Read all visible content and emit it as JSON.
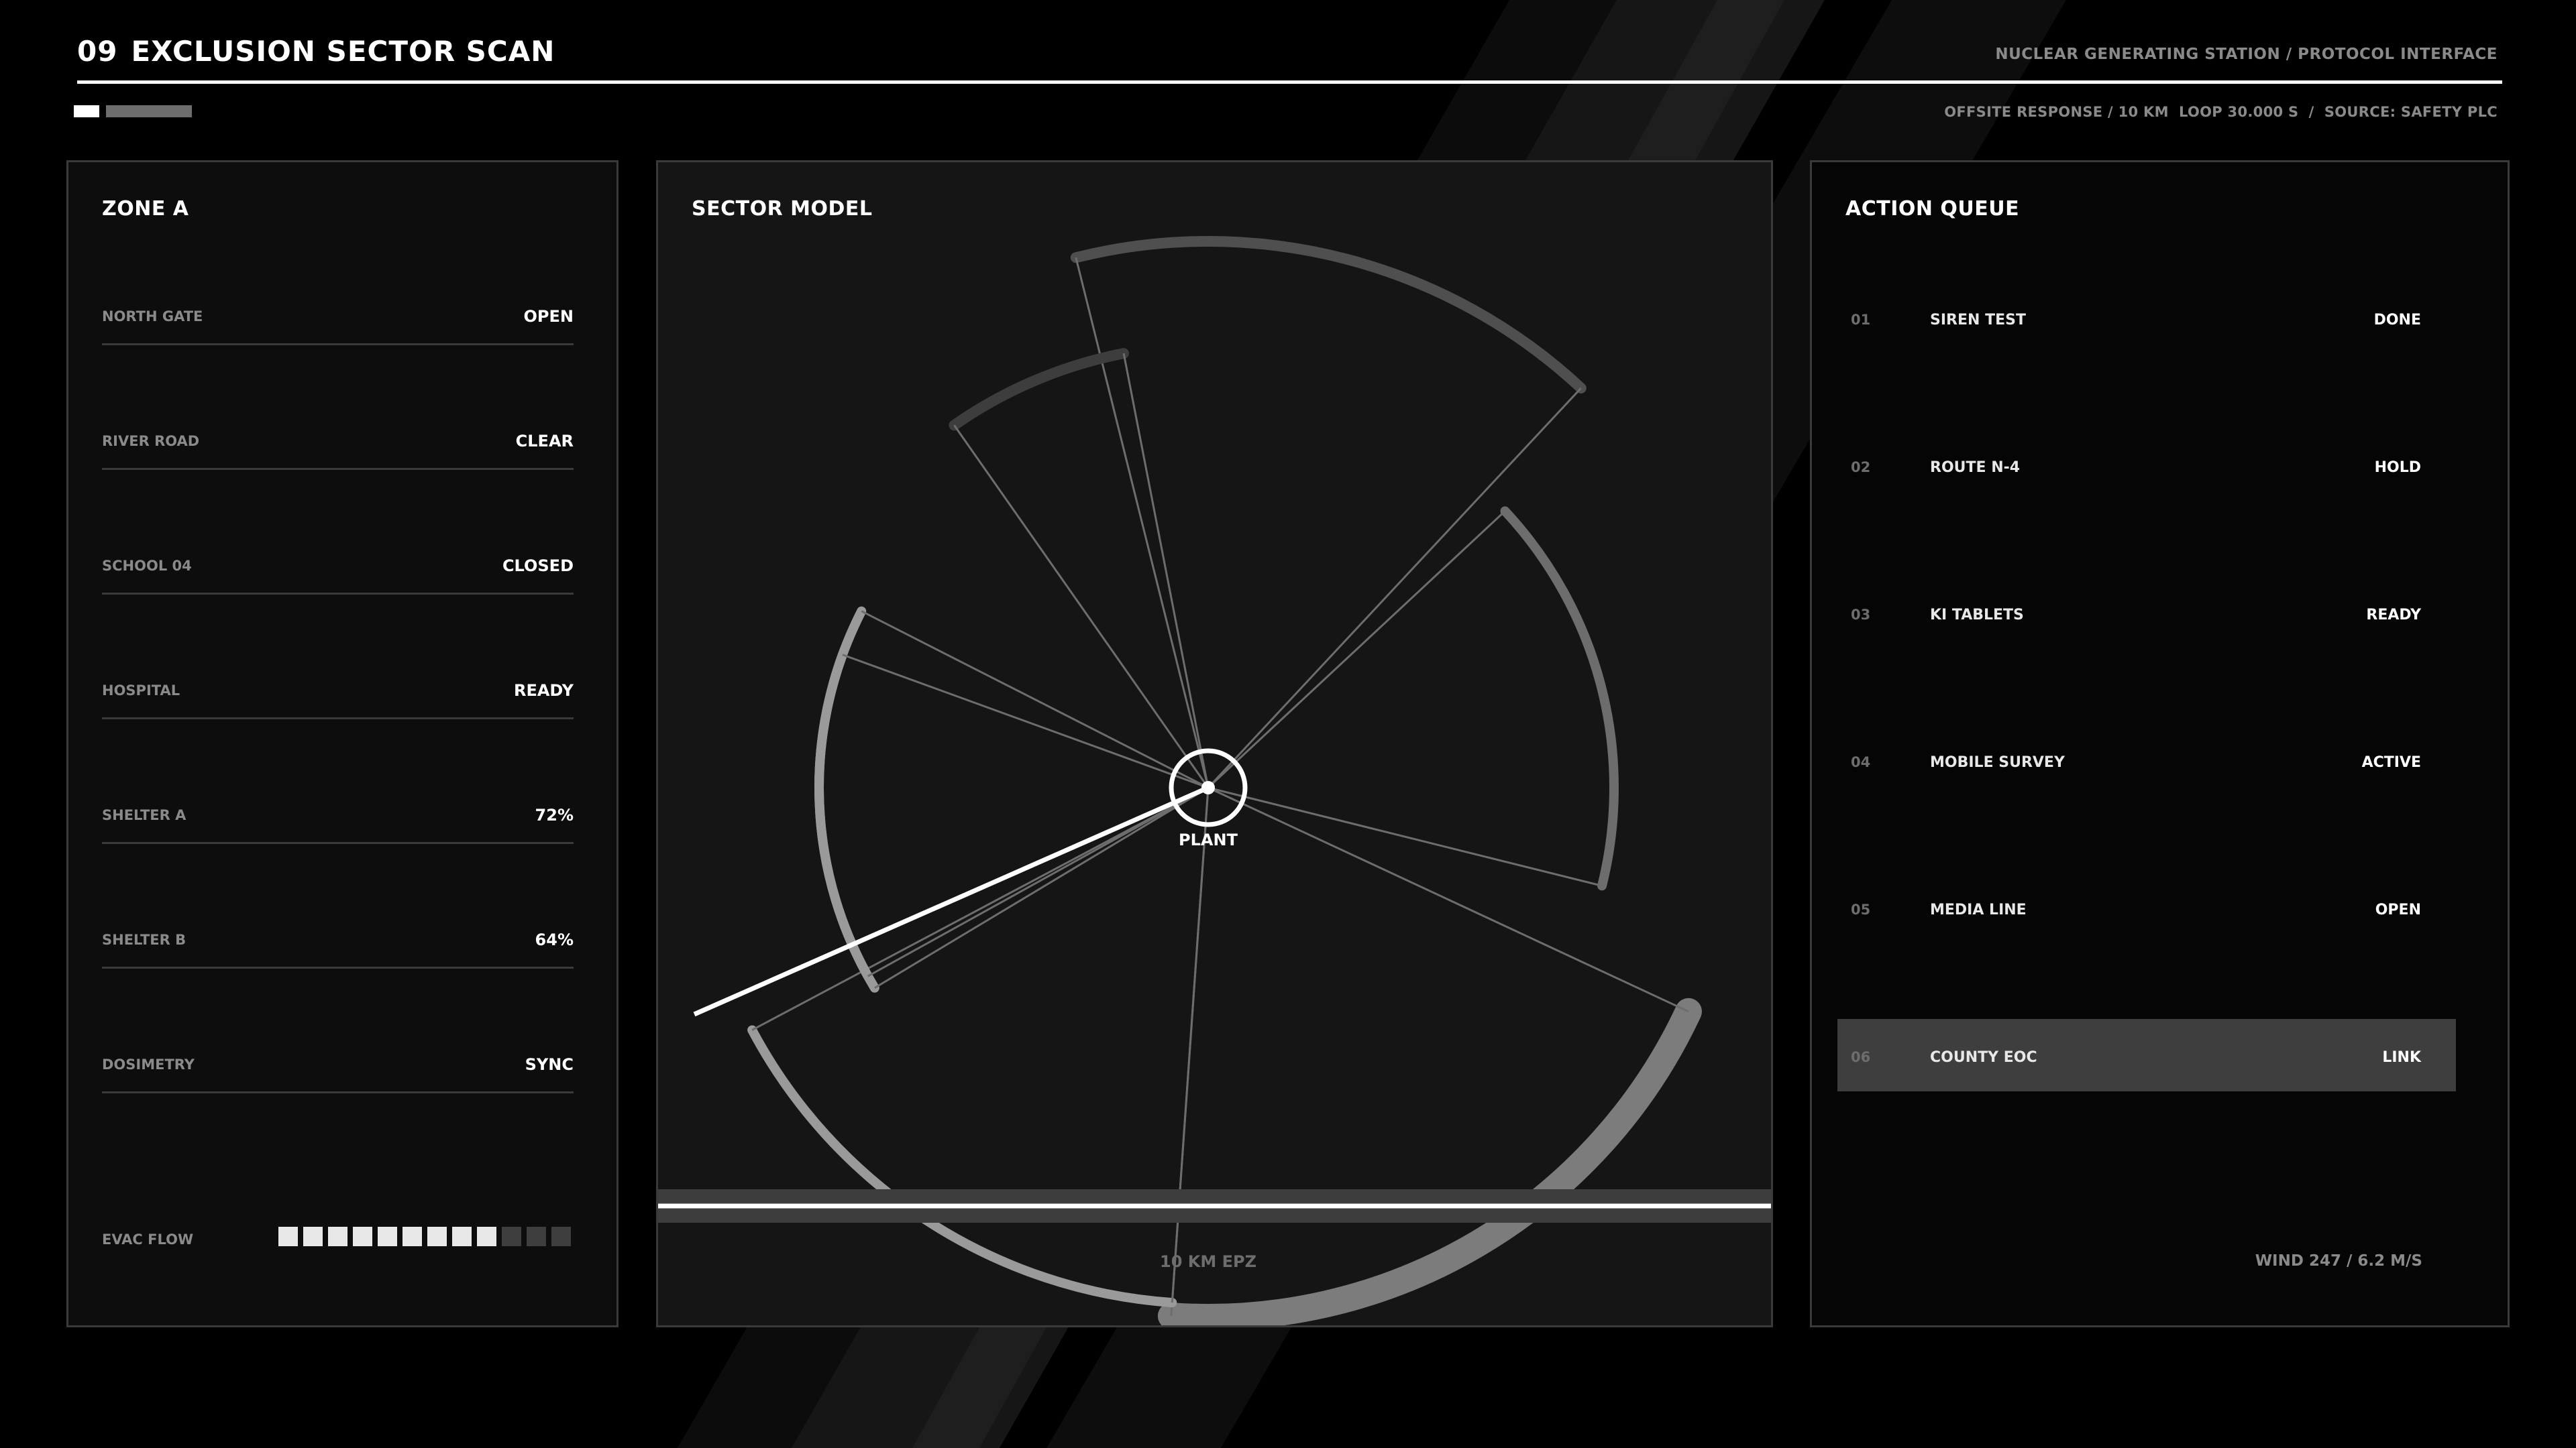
{
  "header": {
    "number": "09",
    "title": "EXCLUSION SECTOR SCAN",
    "right": "NUCLEAR GENERATING STATION / PROTOCOL INTERFACE",
    "sub": "OFFSITE RESPONSE / 10 KM  LOOP 30.000 S  /  SOURCE: SAFETY PLC"
  },
  "zone": {
    "title": "ZONE A",
    "rows": [
      {
        "label": "NORTH GATE",
        "value": "OPEN"
      },
      {
        "label": "RIVER ROAD",
        "value": "CLEAR"
      },
      {
        "label": "SCHOOL 04",
        "value": "CLOSED"
      },
      {
        "label": "HOSPITAL",
        "value": "READY"
      },
      {
        "label": "SHELTER A",
        "value": "72%"
      },
      {
        "label": "SHELTER B",
        "value": "64%"
      },
      {
        "label": "DOSIMETRY",
        "value": "SYNC"
      }
    ],
    "evac_label": "EVAC FLOW",
    "evac_segments_total": 12,
    "evac_segments_filled": 9
  },
  "sector": {
    "title": "SECTOR MODEL",
    "center_label": "PLANT",
    "radius_label": "10 KM EPZ"
  },
  "queue": {
    "title": "ACTION QUEUE",
    "items": [
      {
        "num": "01",
        "name": "SIREN TEST",
        "status": "DONE"
      },
      {
        "num": "02",
        "name": "ROUTE N-4",
        "status": "HOLD"
      },
      {
        "num": "03",
        "name": "KI TABLETS",
        "status": "READY"
      },
      {
        "num": "04",
        "name": "MOBILE SURVEY",
        "status": "ACTIVE"
      },
      {
        "num": "05",
        "name": "MEDIA LINE",
        "status": "OPEN"
      },
      {
        "num": "06",
        "name": "COUNTY EOC",
        "status": "LINK"
      }
    ],
    "active_index": 5,
    "wind": "WIND 247 / 6.2 M/S"
  },
  "colors": {
    "background": "#000000",
    "panel_border": "#3a3a3a",
    "muted_text": "#8a8a8a",
    "highlight_row": "#3e3e3e"
  }
}
